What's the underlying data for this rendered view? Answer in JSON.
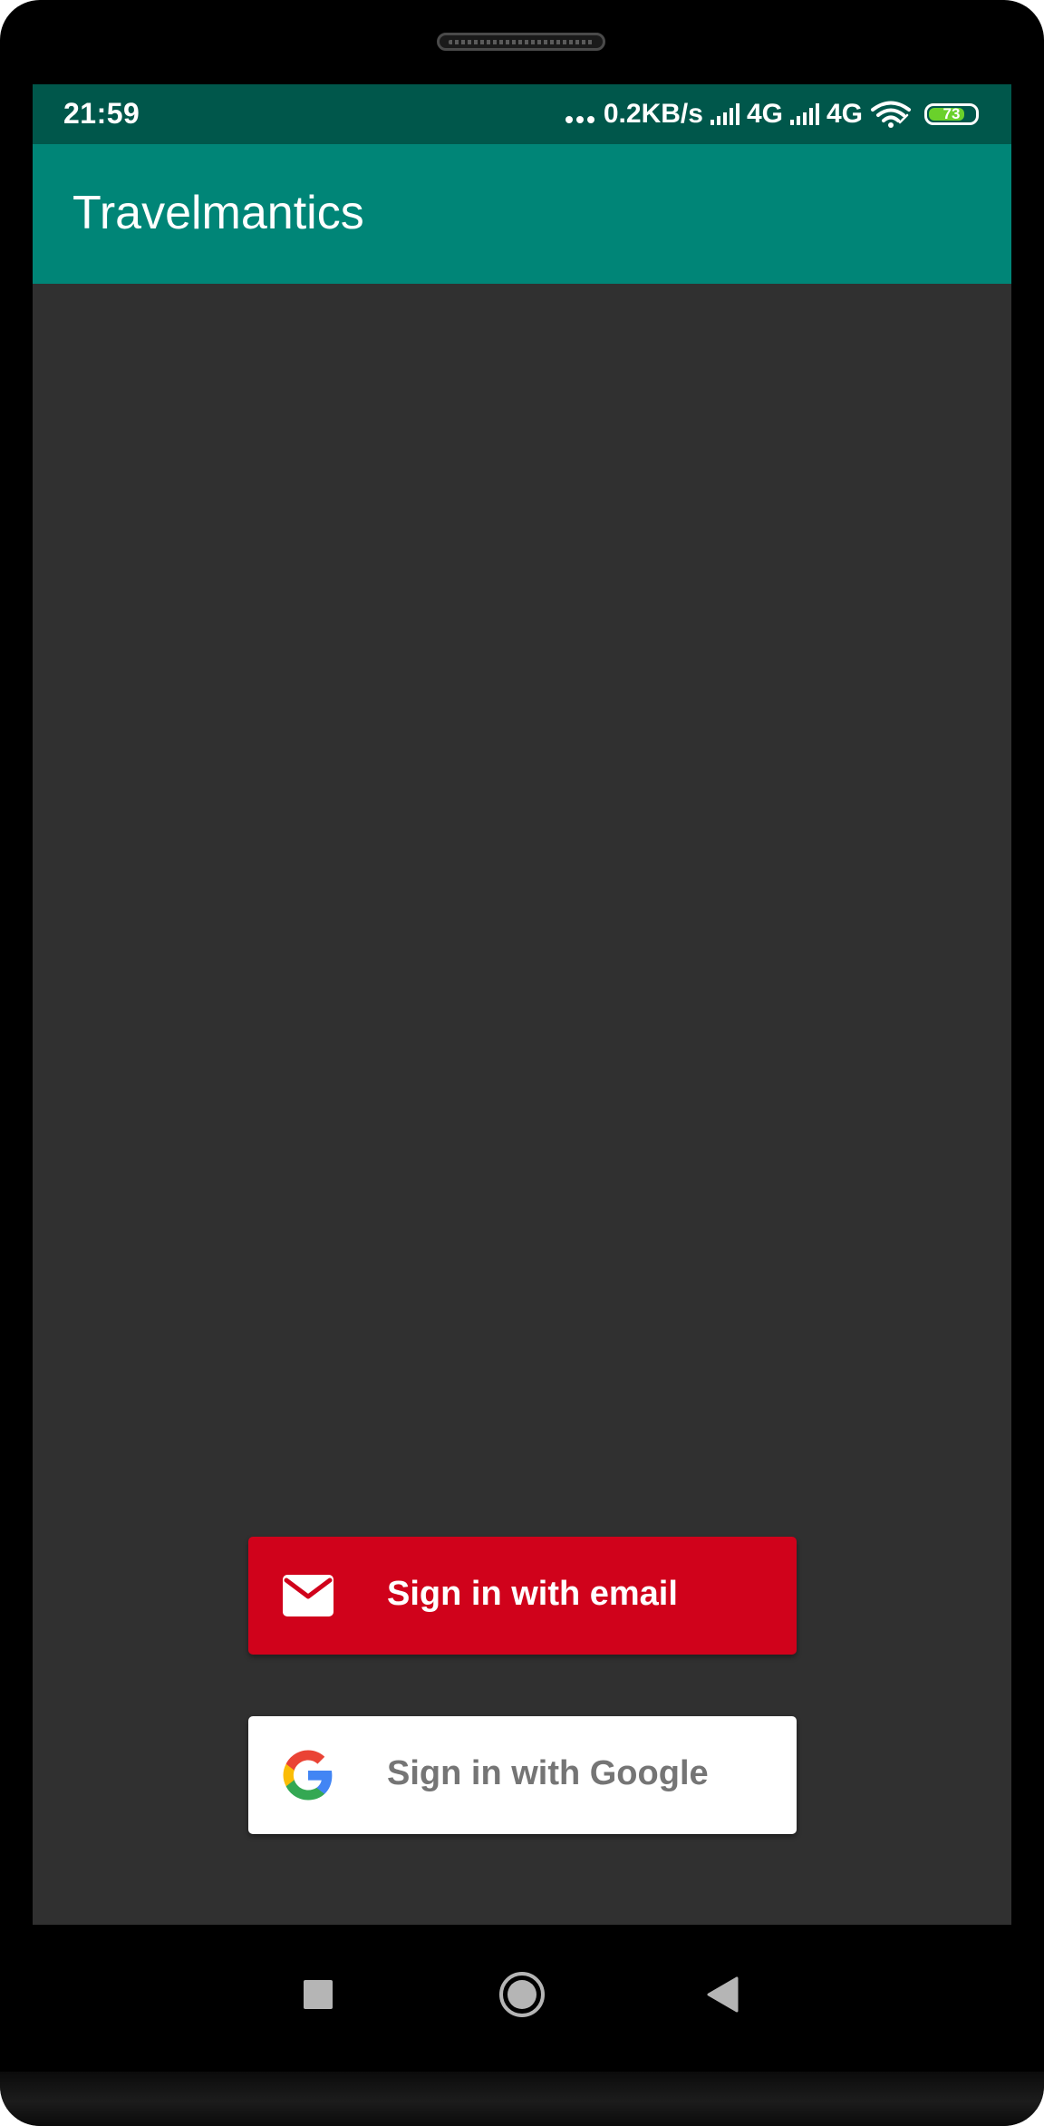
{
  "status_bar": {
    "time": "21:59",
    "network_speed": "0.2KB/s",
    "network_1": "4G",
    "network_2": "4G",
    "battery_level": "73"
  },
  "app_bar": {
    "title": "Travelmantics",
    "color": "#008577",
    "status_color": "#00574b"
  },
  "auth": {
    "email_button": {
      "label": "Sign in with email",
      "icon": "mail-icon",
      "color": "#d0021b"
    },
    "google_button": {
      "label": "Sign in with Google",
      "icon": "google-logo-icon",
      "color": "#ffffff"
    }
  },
  "nav_bar": {
    "items": [
      "recents-button",
      "home-button",
      "back-button"
    ]
  }
}
